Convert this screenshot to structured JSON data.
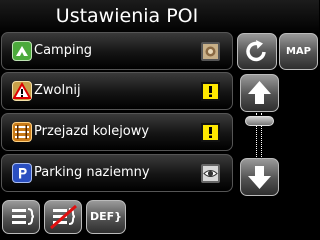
{
  "header": {
    "title": "Ustawienia POI"
  },
  "poi_list": [
    {
      "label": "Camping",
      "icon": "camping-icon",
      "state_icon": "sound-icon"
    },
    {
      "label": "Zwolnij",
      "icon": "warning-triangle-icon",
      "state_icon": "alert-icon"
    },
    {
      "label": "Przejazd kolejowy",
      "icon": "railway-crossing-icon",
      "state_icon": "alert-icon"
    },
    {
      "label": "Parking naziemny",
      "icon": "parking-icon",
      "state_icon": "eye-icon"
    }
  ],
  "side_buttons": {
    "map_label": "MAP"
  },
  "bottom_bar": {
    "def_label": "DEF}"
  },
  "colors": {
    "background": "#000000",
    "alert": "#ffe800",
    "button_gray": "#6a6a6a"
  }
}
